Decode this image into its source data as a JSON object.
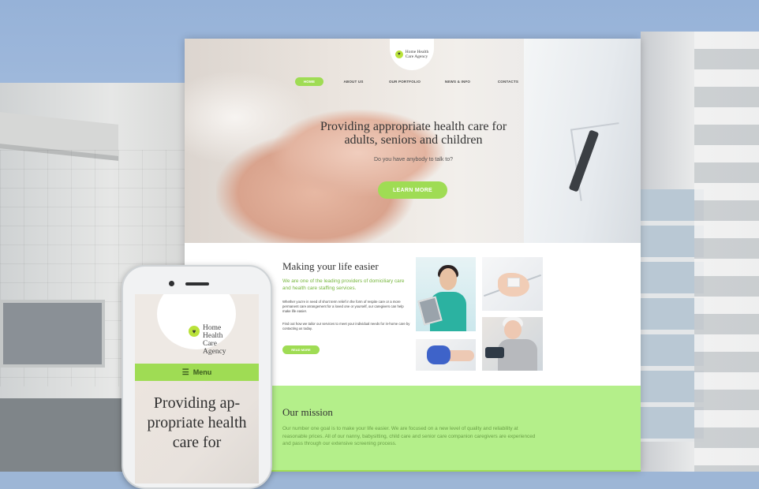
{
  "site": {
    "logo_text": "Home Health\nCare Agency",
    "logo_icon": "heart-icon"
  },
  "nav": {
    "items": [
      {
        "label": "HOME"
      },
      {
        "label": "ABOUT US"
      },
      {
        "label": "OUR PORTFOLIO"
      },
      {
        "label": "NEWS & INFO"
      },
      {
        "label": "CONTACTS"
      }
    ]
  },
  "hero": {
    "title_line1": "Providing appropriate health care for",
    "title_line2": "adults, seniors and children",
    "subtitle": "Do you have anybody to talk to?",
    "button": "LEARN MORE"
  },
  "about": {
    "title": "Making your life easier",
    "lead": "We are one of the leading providers of domiciliary care and health care staffing services.",
    "p1": "Whether you're in need of short term relief in the form of respite care or a more permanent care arrangement for a loved one or yourself, our caregivers can help make life easier.",
    "p2": "Find out how we tailor our services to meet your individual needs for in-home care by contacting us today.",
    "button": "READ MORE"
  },
  "mission": {
    "title": "Our mission",
    "text": "Our number one goal is to make your life easier. We are focused on a new level of quality and reliability at reasonable prices. All of our nanny, babysitting, child care and senior care companion caregivers are experienced and pass through our extensive screening process."
  },
  "phone": {
    "logo_line1": "Home Health",
    "logo_line2": "Care Agency",
    "menu_label": "Menu",
    "menu_icon": "hamburger-icon",
    "title": "Providing ap-propriate health care for"
  },
  "colors": {
    "accent": "#9fdc54",
    "mission_bg": "#b4ef8a",
    "lead_text": "#76b63c"
  }
}
